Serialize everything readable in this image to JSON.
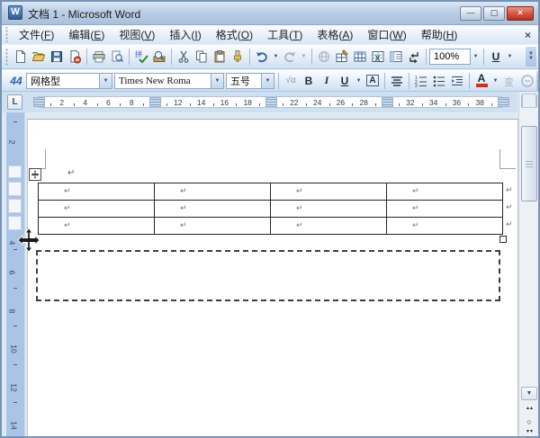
{
  "window": {
    "title": "文档 1 - Microsoft Word",
    "minimize_glyph": "—",
    "maximize_glyph": "▢",
    "close_glyph": "✕"
  },
  "menubar": {
    "items": [
      {
        "label": "文件",
        "accel": "F"
      },
      {
        "label": "编辑",
        "accel": "E"
      },
      {
        "label": "视图",
        "accel": "V"
      },
      {
        "label": "插入",
        "accel": "I"
      },
      {
        "label": "格式",
        "accel": "O"
      },
      {
        "label": "工具",
        "accel": "T"
      },
      {
        "label": "表格",
        "accel": "A"
      },
      {
        "label": "窗口",
        "accel": "W"
      },
      {
        "label": "帮助",
        "accel": "H"
      }
    ],
    "close_glyph": "×"
  },
  "standard_toolbar": {
    "zoom_value": "100%",
    "underline_label": "U",
    "dropdown_glyph": "▼"
  },
  "formatting_toolbar": {
    "styles_pane_label": "44",
    "style_value": "网格型",
    "font_value": "Times New Roma",
    "size_value": "五号",
    "pinyin_label": "√α",
    "bold_label": "B",
    "italic_label": "I",
    "underline_label": "U",
    "char_border_label": "A",
    "font_color_label": "A",
    "dropdown_glyph": "▼"
  },
  "hruler": {
    "tab_selector_label": "L",
    "numbers": [
      "2",
      "4",
      "6",
      "8",
      "12",
      "14",
      "16",
      "18",
      "22",
      "24",
      "26",
      "28",
      "32",
      "34",
      "36",
      "38"
    ]
  },
  "vruler": {
    "numbers": [
      "2",
      "4",
      "6",
      "8",
      "10",
      "12",
      "14"
    ]
  },
  "document": {
    "paragraph_mark": "↵",
    "table": {
      "rows": 3,
      "cols": 4,
      "cell_end_mark": "↵",
      "row_end_mark": "↵",
      "move_handle_glyph": "✥"
    }
  },
  "scrollbar": {
    "up_glyph": "▲",
    "down_glyph": "▼",
    "prev_page_glyph": "▲▲",
    "select_browse_glyph": "○",
    "next_page_glyph": "▼▼"
  },
  "colors": {
    "close_button": "#c2402e",
    "toolbar_bg_top": "#fdfeff",
    "toolbar_bg_bottom": "#cfe0f2",
    "table_border": "#262626",
    "undo_arrow": "#2f62b0"
  }
}
